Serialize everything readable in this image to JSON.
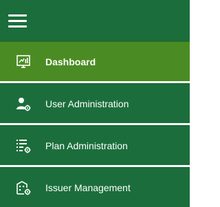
{
  "nav": {
    "items": [
      {
        "label": "Dashboard",
        "icon": "dashboard-monitor-icon",
        "active": true
      },
      {
        "label": "User Administration",
        "icon": "user-gear-icon",
        "active": false
      },
      {
        "label": "Plan Administration",
        "icon": "list-gear-icon",
        "active": false
      },
      {
        "label": "Issuer Management",
        "icon": "building-gear-icon",
        "active": false
      }
    ]
  },
  "colors": {
    "sidebar_bg": "#1b6e3b",
    "active_bg": "#4a8c23",
    "text": "#ffffff"
  }
}
